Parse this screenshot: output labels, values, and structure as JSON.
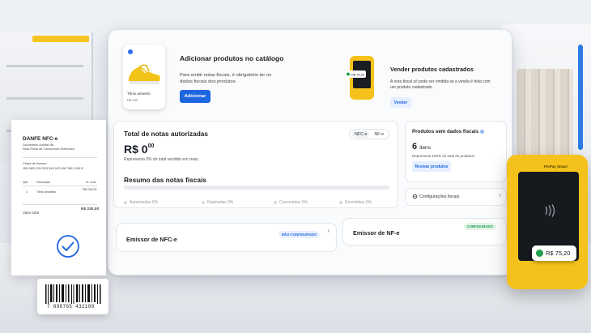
{
  "catalog": {
    "title": "Adicionar produtos no catálogo",
    "text": "Para emitir notas fiscais, é obrigatório ter os dados fiscais dos produtos.",
    "button": "Adicionar",
    "product_name": "Tênis amarelo",
    "product_price": "R$ 230"
  },
  "sell": {
    "title": "Vender produtos cadastrados",
    "text": "A nota fiscal só pode ser emitida se a venda é feita com um produto cadastrado.",
    "button": "Vender",
    "mini_amount": "R$ 75,20"
  },
  "notes": {
    "title": "Total de notas autorizadas",
    "toggle": [
      "NFC-e",
      "NF-e"
    ],
    "value_main": "R$ 0",
    "value_cents": "00",
    "description": "Representa 0% do total vendido em reais.",
    "summary_title": "Resumo das notas fiscais",
    "legend": [
      "Autorizadas 0%",
      "Rejeitadas 0%",
      "Canceladas 0%",
      "Devolvidas 0%"
    ]
  },
  "missing": {
    "title": "Produtos sem dados fiscais",
    "count": "6",
    "count_unit": "itens",
    "description": "Representa 100% do total de produtos",
    "button": "Revisar produtos"
  },
  "settings": {
    "label": "Configurações fiscais"
  },
  "emitters": {
    "nfce": {
      "label": "Emissor de NFC-e",
      "status": "NÃO CONFIGURADO"
    },
    "nfe": {
      "label": "Emissor de NF-e",
      "status": "CONFIGURADO"
    }
  },
  "receipt": {
    "title": "DANFE NFC-e",
    "subtitle1": "Documento Auxiliar da",
    "subtitle2": "Nota Fiscal de Consumidor Eletrônica",
    "key_label": "Chave de Acesso",
    "key_value": "3524 0605 1234 5678 9000 0123 4567 8901 2345 67",
    "col_qtd": "Qtd",
    "col_desc": "Descrição",
    "col_unit": "Vl. Unit.",
    "row_qtd": "1",
    "row_desc": "Tênis amarelo",
    "row_value": "R$ 230,00",
    "total_label": "Valor total",
    "total_value": "R$ 230,00"
  },
  "barcode": {
    "number": "7 898765 432109"
  },
  "terminal": {
    "brand": "PicPay Smart",
    "amount": "R$ 75,20"
  },
  "colors": {
    "primary": "#1e66e0",
    "terminal": "#f4c21b",
    "success": "#22a04b"
  }
}
